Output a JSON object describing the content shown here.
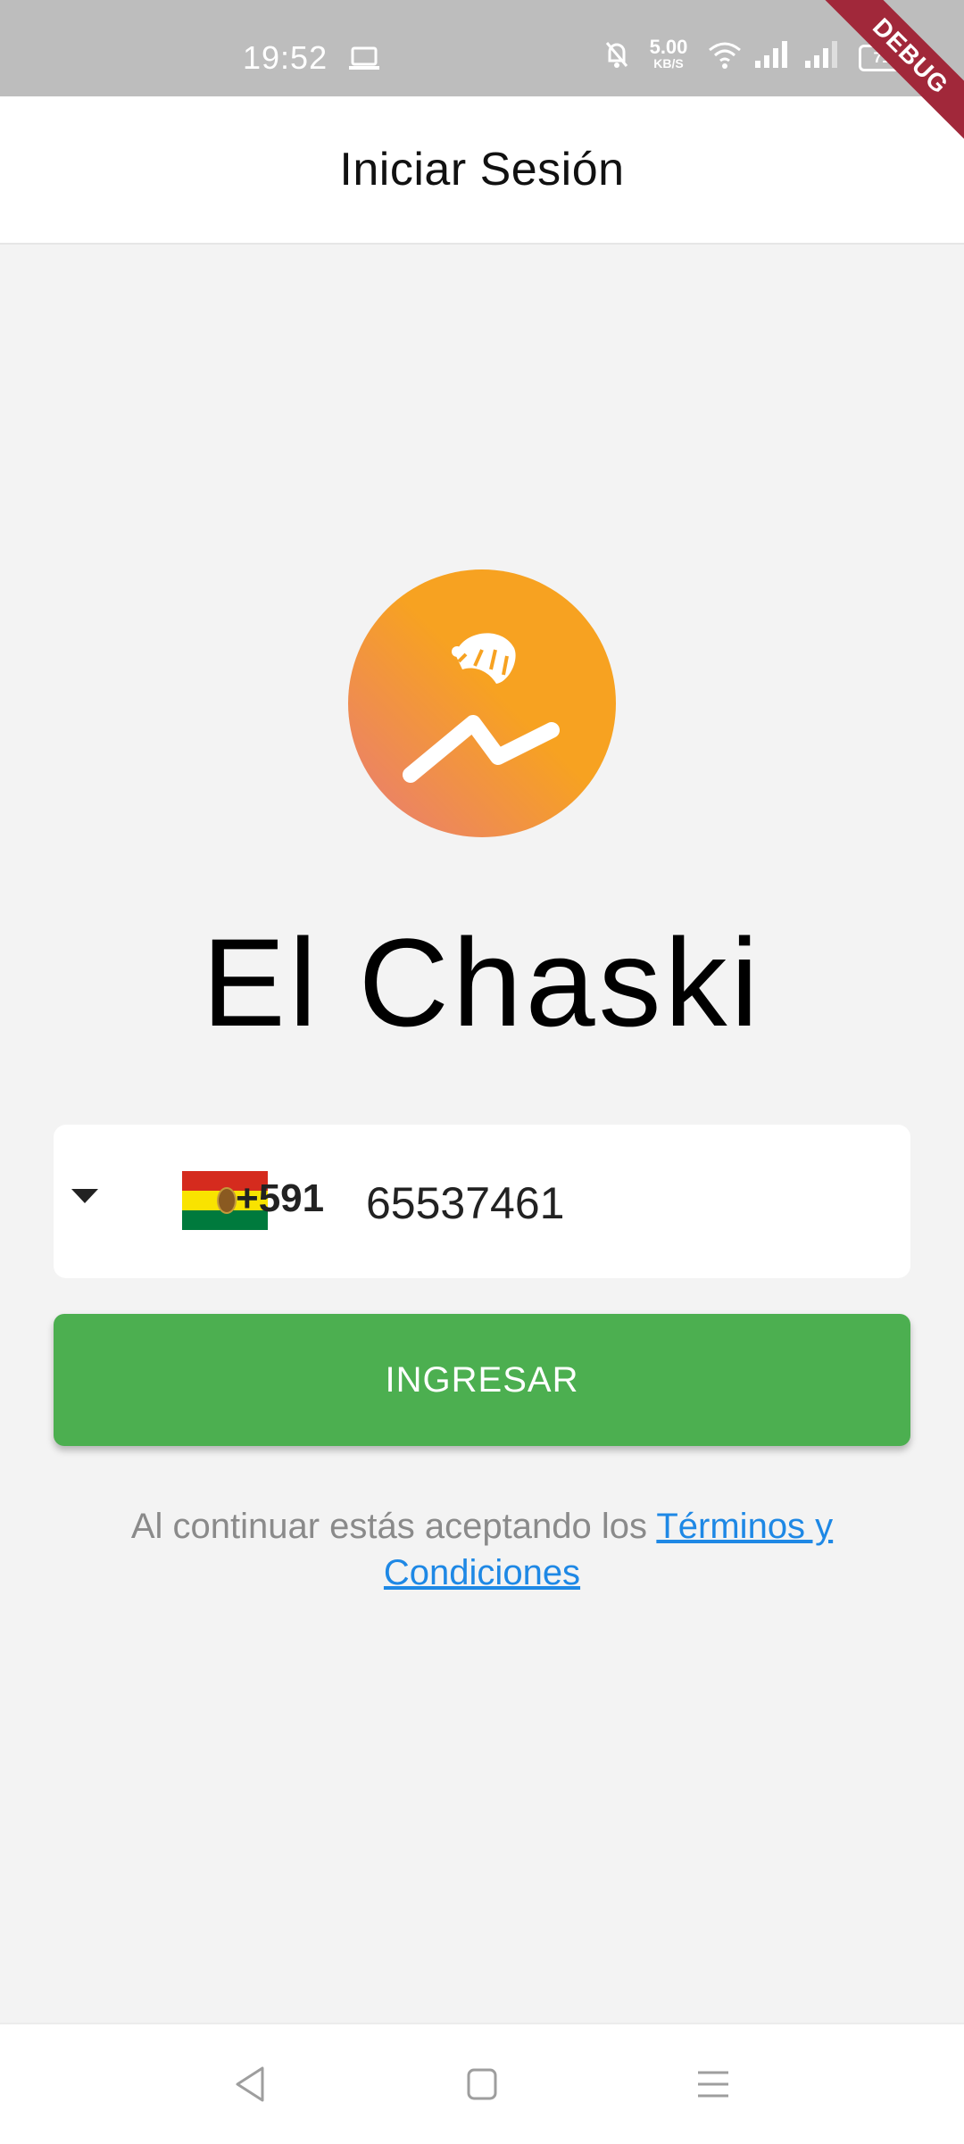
{
  "status_bar": {
    "time": "19:52",
    "net_speed_value": "5.00",
    "net_speed_unit": "KB/S",
    "battery": "71",
    "icons": [
      "laptop-icon",
      "mute-bell-icon",
      "wifi-icon",
      "signal-icon",
      "signal-icon-2",
      "battery-icon"
    ]
  },
  "debug_banner": "DEBUG",
  "app_bar": {
    "title": "Iniciar Sesión"
  },
  "brand": {
    "name": "El Chaski",
    "logo_gradient": [
      "#e87a78",
      "#f7a221"
    ]
  },
  "phone": {
    "country_flag": "bolivia-flag",
    "dial_code": "+591",
    "number": "65537461"
  },
  "actions": {
    "login_label": "INGRESAR",
    "login_color": "#4caf50"
  },
  "terms": {
    "prefix": "Al continuar estás aceptando los ",
    "link": "Términos y Condiciones",
    "link_color": "#1e88e5"
  },
  "nav_bar": {
    "icons": [
      "back-icon",
      "home-icon",
      "menu-icon"
    ]
  }
}
